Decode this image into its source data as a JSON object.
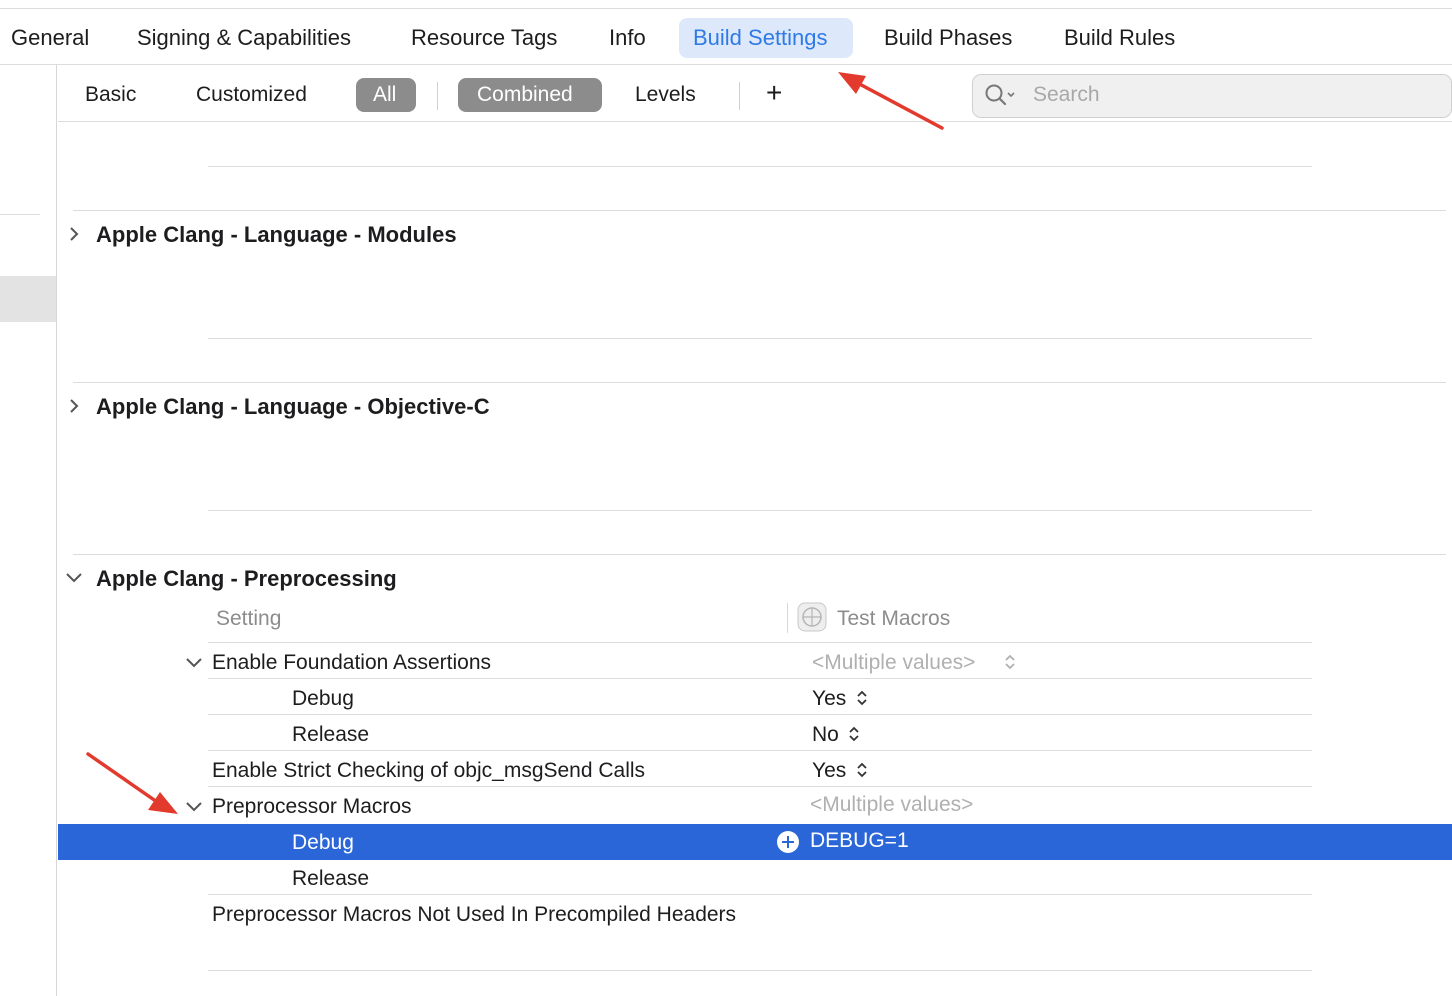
{
  "tabs": [
    "General",
    "Signing & Capabilities",
    "Resource Tags",
    "Info",
    "Build Settings",
    "Build Phases",
    "Build Rules"
  ],
  "active_tab": "Build Settings",
  "filters": {
    "basic": "Basic",
    "customized": "Customized",
    "all": "All",
    "combined": "Combined",
    "levels": "Levels",
    "add": "+"
  },
  "search": {
    "placeholder": "Search"
  },
  "sections": {
    "modules": "Apple Clang - Language - Modules",
    "objc": "Apple Clang - Language - Objective-C",
    "preprocessing": "Apple Clang - Preprocessing"
  },
  "table": {
    "setting_header": "Setting",
    "target_header": "Test Macros",
    "rows": {
      "foundation": {
        "label": "Enable Foundation Assertions",
        "value": "<Multiple values>"
      },
      "foundation_debug": {
        "label": "Debug",
        "value": "Yes"
      },
      "foundation_release": {
        "label": "Release",
        "value": "No"
      },
      "strict": {
        "label": "Enable Strict Checking of objc_msgSend Calls",
        "value": "Yes"
      },
      "macros": {
        "label": "Preprocessor Macros",
        "value": "<Multiple values>"
      },
      "macros_debug": {
        "label": "Debug",
        "value": "DEBUG=1"
      },
      "macros_release": {
        "label": "Release",
        "value": ""
      },
      "not_used": {
        "label": "Preprocessor Macros Not Used In Precompiled Headers",
        "value": ""
      }
    }
  },
  "colors": {
    "accent": "#2f7ae5",
    "selection": "#2a66d8",
    "annotation_arrow": "#e23b2e"
  }
}
